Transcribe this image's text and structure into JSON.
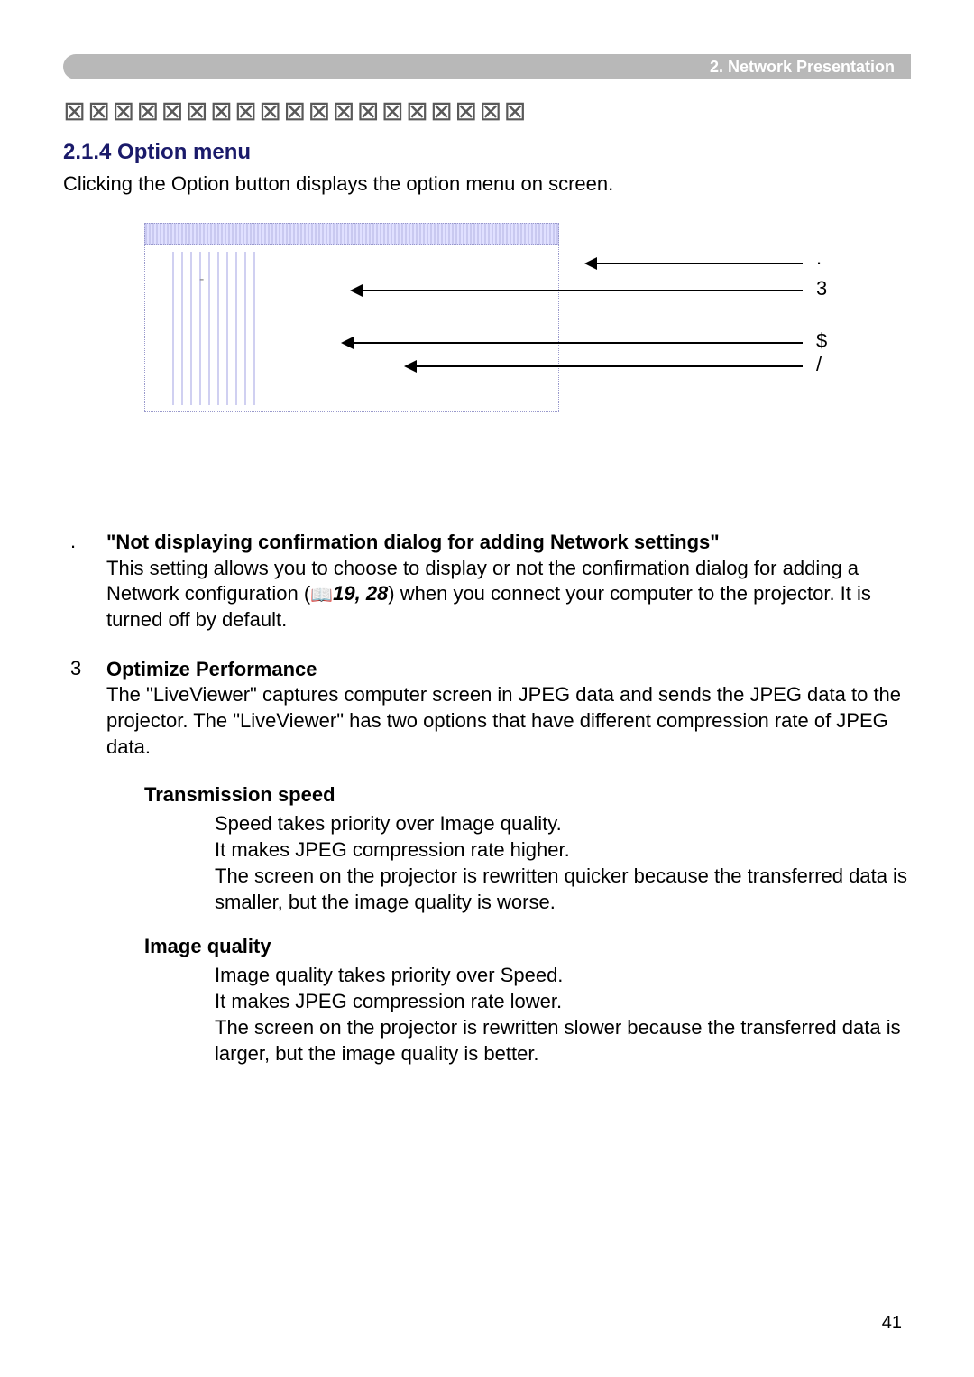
{
  "header": {
    "breadcrumb": "2. Network Presentation"
  },
  "garbled": "⊠⊠⊠⊠⊠⊠⊠⊠⊠⊠⊠⊠⊠⊠⊠⊠⊠⊠⊠",
  "section": {
    "number_title": "2.1.4 Option menu",
    "intro": "Clicking the Option button displays the option menu on screen."
  },
  "figure": {
    "labels": {
      "one": ".",
      "two": "3",
      "three": "$",
      "four": "/"
    }
  },
  "items": {
    "first": {
      "marker": ".",
      "title": "\"Not displaying confirmation dialog for adding Network settings\"",
      "body_pre": "This setting allows you to choose to display or not the confirmation dialog for adding a Network configuration (",
      "ref": "19, 28",
      "body_post": ") when you connect your computer to the projector. It is turned off by default."
    },
    "second": {
      "marker": "3",
      "title": "Optimize Performance",
      "body": "The \"LiveViewer\" captures computer screen in JPEG data and sends the JPEG data to the projector. The \"LiveViewer\" has two options that have different compression rate of JPEG data."
    }
  },
  "subs": {
    "speed": {
      "title": "Transmission speed",
      "text": "Speed takes priority over Image quality.\nIt makes JPEG compression rate higher.\nThe screen on the projector is rewritten quicker because the transferred data is smaller, but the image quality is worse."
    },
    "quality": {
      "title": "Image quality",
      "text": "Image quality takes priority over Speed.\nIt makes JPEG compression rate lower.\nThe screen on the projector is rewritten slower because the transferred data is larger, but the image quality is better."
    }
  },
  "page_number": "41"
}
